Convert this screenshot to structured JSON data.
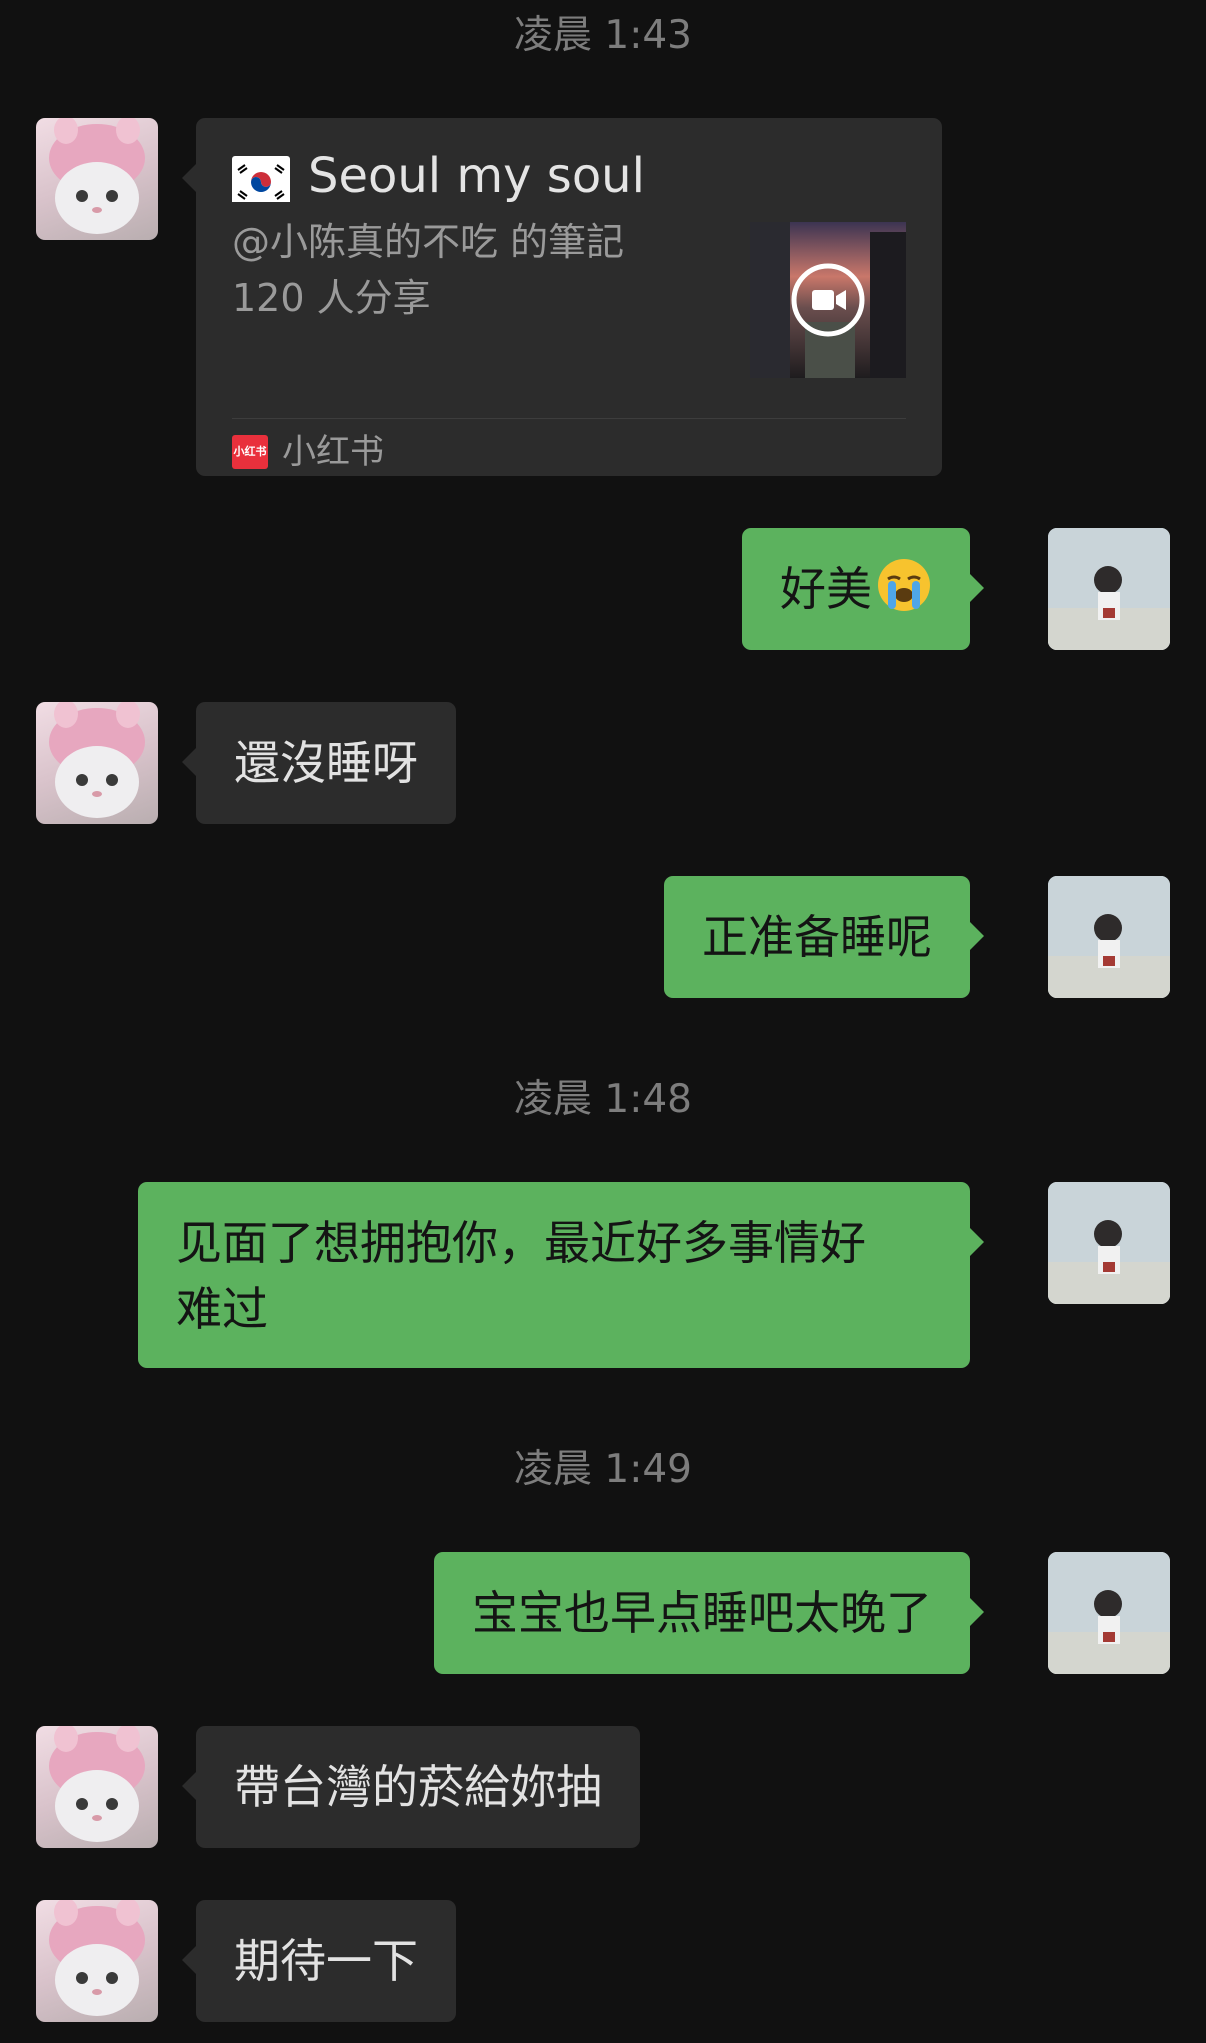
{
  "timestamps": [
    "凌晨 1:43",
    "凌晨 1:48",
    "凌晨 1:49"
  ],
  "share_card": {
    "title": "Seoul my soul",
    "author": "@小陈真的不吃 的筆記",
    "shares": "120 人分享",
    "source": "小红书",
    "source_logo_text": "小红书",
    "flag_icon": "south-korea-flag-icon",
    "thumbnail_icon": "video-camera-icon"
  },
  "messages": {
    "m1": "好美",
    "m1_emoji": "crying-face-emoji",
    "m2": "還沒睡呀",
    "m3": "正准备睡呢",
    "m4_line1": "见面了想拥抱你，最近好多事情好",
    "m4_line2": "难过",
    "m5": "宝宝也早点睡吧太晚了",
    "m6": "帶台灣的菸給妳抽",
    "m7": "期待一下"
  },
  "colors": {
    "background": "#111111",
    "incoming_bubble": "#2c2c2c",
    "outgoing_bubble": "#5cb25e",
    "timestamp": "#7d7d7d"
  }
}
